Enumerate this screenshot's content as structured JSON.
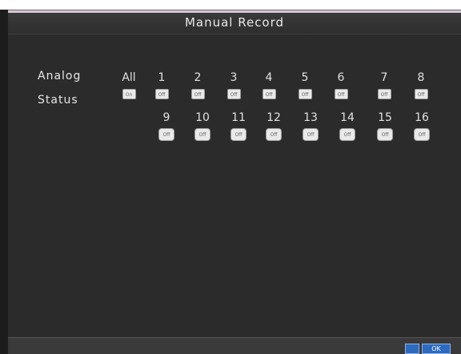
{
  "window": {
    "title": "Manual Record"
  },
  "labels": {
    "analog": "Analog",
    "status": "Status"
  },
  "row1": [
    {
      "num": "All",
      "status": "On"
    },
    {
      "num": "1",
      "status": "Off"
    },
    {
      "num": "2",
      "status": "Off"
    },
    {
      "num": "3",
      "status": "Off"
    },
    {
      "num": "4",
      "status": "Off"
    },
    {
      "num": "5",
      "status": "Off"
    },
    {
      "num": "6",
      "status": "Off"
    },
    {
      "num": "7",
      "status": "Off"
    },
    {
      "num": "8",
      "status": "Off"
    }
  ],
  "row2": [
    {
      "num": "9",
      "status": "Off"
    },
    {
      "num": "10",
      "status": "Off"
    },
    {
      "num": "11",
      "status": "Off"
    },
    {
      "num": "12",
      "status": "Off"
    },
    {
      "num": "13",
      "status": "Off"
    },
    {
      "num": "14",
      "status": "Off"
    },
    {
      "num": "15",
      "status": "Off"
    },
    {
      "num": "16",
      "status": "Off"
    }
  ],
  "footer": {
    "ok_label": "",
    "cancel_label": "OK"
  },
  "colors": {
    "accent": "#2d6bbf",
    "title_border": "#d6c7d6",
    "background": "#2b2b2b"
  }
}
